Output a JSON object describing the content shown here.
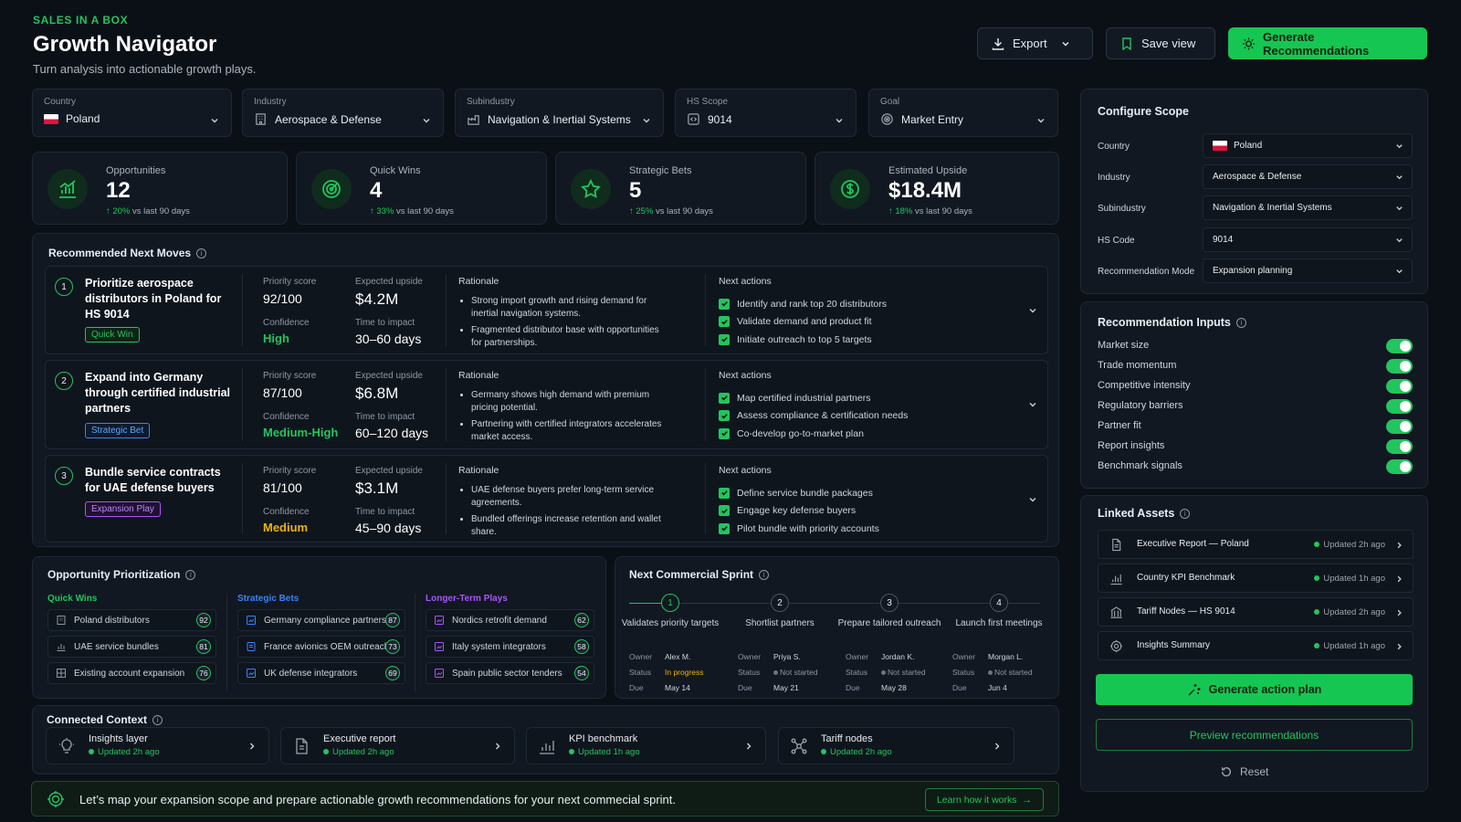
{
  "header": {
    "brand": "SALES IN A BOX",
    "title": "Growth Navigator",
    "subtitle": "Turn analysis into actionable growth plays.",
    "export_label": "Export",
    "save_label": "Save view",
    "generate_label": "Generate Recommendations"
  },
  "filters": [
    {
      "label": "Country",
      "value": "Poland",
      "icon": "poland-flag"
    },
    {
      "label": "Industry",
      "value": "Aerospace & Defense",
      "icon": "building-icon"
    },
    {
      "label": "Subindustry",
      "value": "Navigation & Inertial Systems",
      "icon": "factory-icon"
    },
    {
      "label": "HS Scope",
      "value": "9014",
      "icon": "code-icon"
    },
    {
      "label": "Goal",
      "value": "Market Entry",
      "icon": "target-icon"
    }
  ],
  "kpis": [
    {
      "name": "Opportunities",
      "value": "12",
      "delta": "20%",
      "delta_text": "vs last 90 days",
      "icon": "bar-chart-icon"
    },
    {
      "name": "Quick Wins",
      "value": "4",
      "delta": "33%",
      "delta_text": "vs last 90 days",
      "icon": "target-icon"
    },
    {
      "name": "Strategic Bets",
      "value": "5",
      "delta": "25%",
      "delta_text": "vs last 90 days",
      "icon": "star-icon"
    },
    {
      "name": "Estimated Upside",
      "value": "$18.4M",
      "delta": "18%",
      "delta_text": "vs last 90 days",
      "icon": "dollar-icon"
    }
  ],
  "moves": {
    "title": "Recommended Next Moves",
    "labels": {
      "priority": "Priority score",
      "confidence": "Confidence",
      "upside": "Expected upside",
      "time": "Time to impact",
      "rationale": "Rationale",
      "actions": "Next actions"
    },
    "items": [
      {
        "num": "1",
        "title": "Prioritize aerospace distributors in Poland for HS 9014",
        "tag": "Quick Win",
        "priority": "92/100",
        "confidence": "High",
        "upside": "$4.2M",
        "time": "30–60 days",
        "rationale": [
          "Strong import growth and rising demand for inertial navigation systems.",
          "Fragmented distributor base with opportunities for partnerships."
        ],
        "actions": [
          "Identify and rank top 20 distributors",
          "Validate demand and product fit",
          "Initiate outreach to top 5 targets"
        ]
      },
      {
        "num": "2",
        "title": "Expand into Germany through certified industrial partners",
        "tag": "Strategic Bet",
        "priority": "87/100",
        "confidence": "Medium-High",
        "upside": "$6.8M",
        "time": "60–120 days",
        "rationale": [
          "Germany shows high demand with premium pricing potential.",
          "Partnering with certified integrators accelerates market access."
        ],
        "actions": [
          "Map certified industrial partners",
          "Assess compliance & certification needs",
          "Co-develop go-to-market plan"
        ]
      },
      {
        "num": "3",
        "title": "Bundle service contracts for UAE defense buyers",
        "tag": "Expansion Play",
        "priority": "81/100",
        "confidence": "Medium",
        "upside": "$3.1M",
        "time": "45–90 days",
        "rationale": [
          "UAE defense buyers prefer long-term service agreements.",
          "Bundled offerings increase retention and wallet share."
        ],
        "actions": [
          "Define service bundle packages",
          "Engage key defense buyers",
          "Pilot bundle with priority accounts"
        ]
      }
    ]
  },
  "prioritization": {
    "title": "Opportunity Prioritization",
    "columns": [
      {
        "name": "Quick Wins",
        "color": "#22c55e",
        "items": [
          {
            "label": "Poland distributors",
            "score": "92"
          },
          {
            "label": "UAE service bundles",
            "score": "81"
          },
          {
            "label": "Existing account expansion",
            "score": "76"
          }
        ]
      },
      {
        "name": "Strategic Bets",
        "color": "#3b82f6",
        "items": [
          {
            "label": "Germany compliance partners",
            "score": "87"
          },
          {
            "label": "France avionics OEM outreach",
            "score": "73"
          },
          {
            "label": "UK defense integrators",
            "score": "69"
          }
        ]
      },
      {
        "name": "Longer-Term Plays",
        "color": "#a855f7",
        "items": [
          {
            "label": "Nordics retrofit demand",
            "score": "62"
          },
          {
            "label": "Italy system integrators",
            "score": "58"
          },
          {
            "label": "Spain public sector tenders",
            "score": "54"
          }
        ]
      }
    ]
  },
  "sprint": {
    "title": "Next Commercial Sprint",
    "owner_label": "Owner",
    "status_label": "Status",
    "due_label": "Due",
    "steps": [
      {
        "num": "1",
        "title": "Validates priority targets",
        "owner": "Alex M.",
        "status": "In progress",
        "due": "May 14"
      },
      {
        "num": "2",
        "title": "Shortlist partners",
        "owner": "Priya S.",
        "status": "Not started",
        "due": "May 21"
      },
      {
        "num": "3",
        "title": "Prepare tailored outreach",
        "owner": "Jordan K.",
        "status": "Not started",
        "due": "May 28"
      },
      {
        "num": "4",
        "title": "Launch first meetings",
        "owner": "Morgan L.",
        "status": "Not started",
        "due": "Jun 4"
      }
    ]
  },
  "context": {
    "title": "Connected Context",
    "items": [
      {
        "name": "Insights layer",
        "updated": "Updated 2h ago",
        "icon": "lightbulb-icon"
      },
      {
        "name": "Executive report",
        "updated": "Updated 2h ago",
        "icon": "document-icon"
      },
      {
        "name": "KPI benchmark",
        "updated": "Updated 1h ago",
        "icon": "bar-chart-icon"
      },
      {
        "name": "Tariff nodes",
        "updated": "Updated 2h ago",
        "icon": "network-icon"
      }
    ]
  },
  "banner": {
    "text": "Let’s map your expansion scope and prepare actionable growth recommendations for your next commecial sprint.",
    "link": "Learn how it works"
  },
  "scope": {
    "title": "Configure Scope",
    "fields": [
      {
        "label": "Country",
        "value": "Poland"
      },
      {
        "label": "Industry",
        "value": "Aerospace & Defense"
      },
      {
        "label": "Subindustry",
        "value": "Navigation & Inertial Systems"
      },
      {
        "label": "HS Code",
        "value": "9014"
      },
      {
        "label": "Recommendation Mode",
        "value": "Expansion planning"
      }
    ]
  },
  "inputs": {
    "title": "Recommendation Inputs",
    "items": [
      "Market size",
      "Trade momentum",
      "Competitive intensity",
      "Regulatory barriers",
      "Partner fit",
      "Report insights",
      "Benchmark signals"
    ]
  },
  "assets": {
    "title": "Linked Assets",
    "items": [
      {
        "name": "Executive Report — Poland",
        "updated": "Updated 2h ago",
        "icon": "document-icon"
      },
      {
        "name": "Country KPI Benchmark",
        "updated": "Updated 1h ago",
        "icon": "bar-chart-icon"
      },
      {
        "name": "Tariff Nodes — HS 9014",
        "updated": "Updated 2h ago",
        "icon": "building-icon"
      },
      {
        "name": "Insights Summary",
        "updated": "Updated 1h ago",
        "icon": "gear-icon"
      }
    ]
  },
  "actions": {
    "plan_label": "Generate action plan",
    "preview_label": "Preview recommendations",
    "reset_label": "Reset"
  },
  "colors": {
    "accent": "#22c55e",
    "background": "#0b1017",
    "card": "#111821",
    "strategic": "#3b82f6",
    "expansion": "#a855f7",
    "medium": "#eab308"
  }
}
